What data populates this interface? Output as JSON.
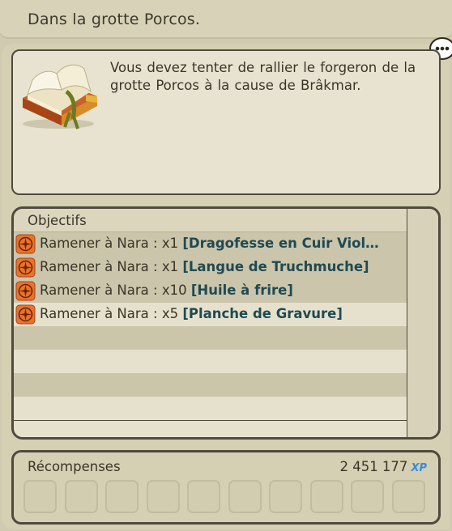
{
  "quest": {
    "title": "Dans la grotte Porcos.",
    "description": "Vous devez tenter de rallier le forgeron de la grotte Porcos à la cause de Brâkmar."
  },
  "objectives": {
    "header": "Objectifs",
    "items": [
      {
        "text": "Ramener à Nara : x1 ",
        "item": "[Dragofesse en Cuir Viol…"
      },
      {
        "text": "Ramener à Nara : x1 ",
        "item": "[Langue de Truchmuche]"
      },
      {
        "text": "Ramener à Nara : x10 ",
        "item": "[Huile à frire]"
      },
      {
        "text": "Ramener à Nara : x5 ",
        "item": "[Planche de Gravure]"
      }
    ]
  },
  "rewards": {
    "label": "Récompenses",
    "xp_value": "2 451 177",
    "xp_unit": "XP"
  },
  "colors": {
    "item_link": "#1f4a52",
    "xp_badge": "#3a8bd8"
  },
  "icons": [
    "book-icon",
    "chat-bubble-icon",
    "compass-icon"
  ]
}
